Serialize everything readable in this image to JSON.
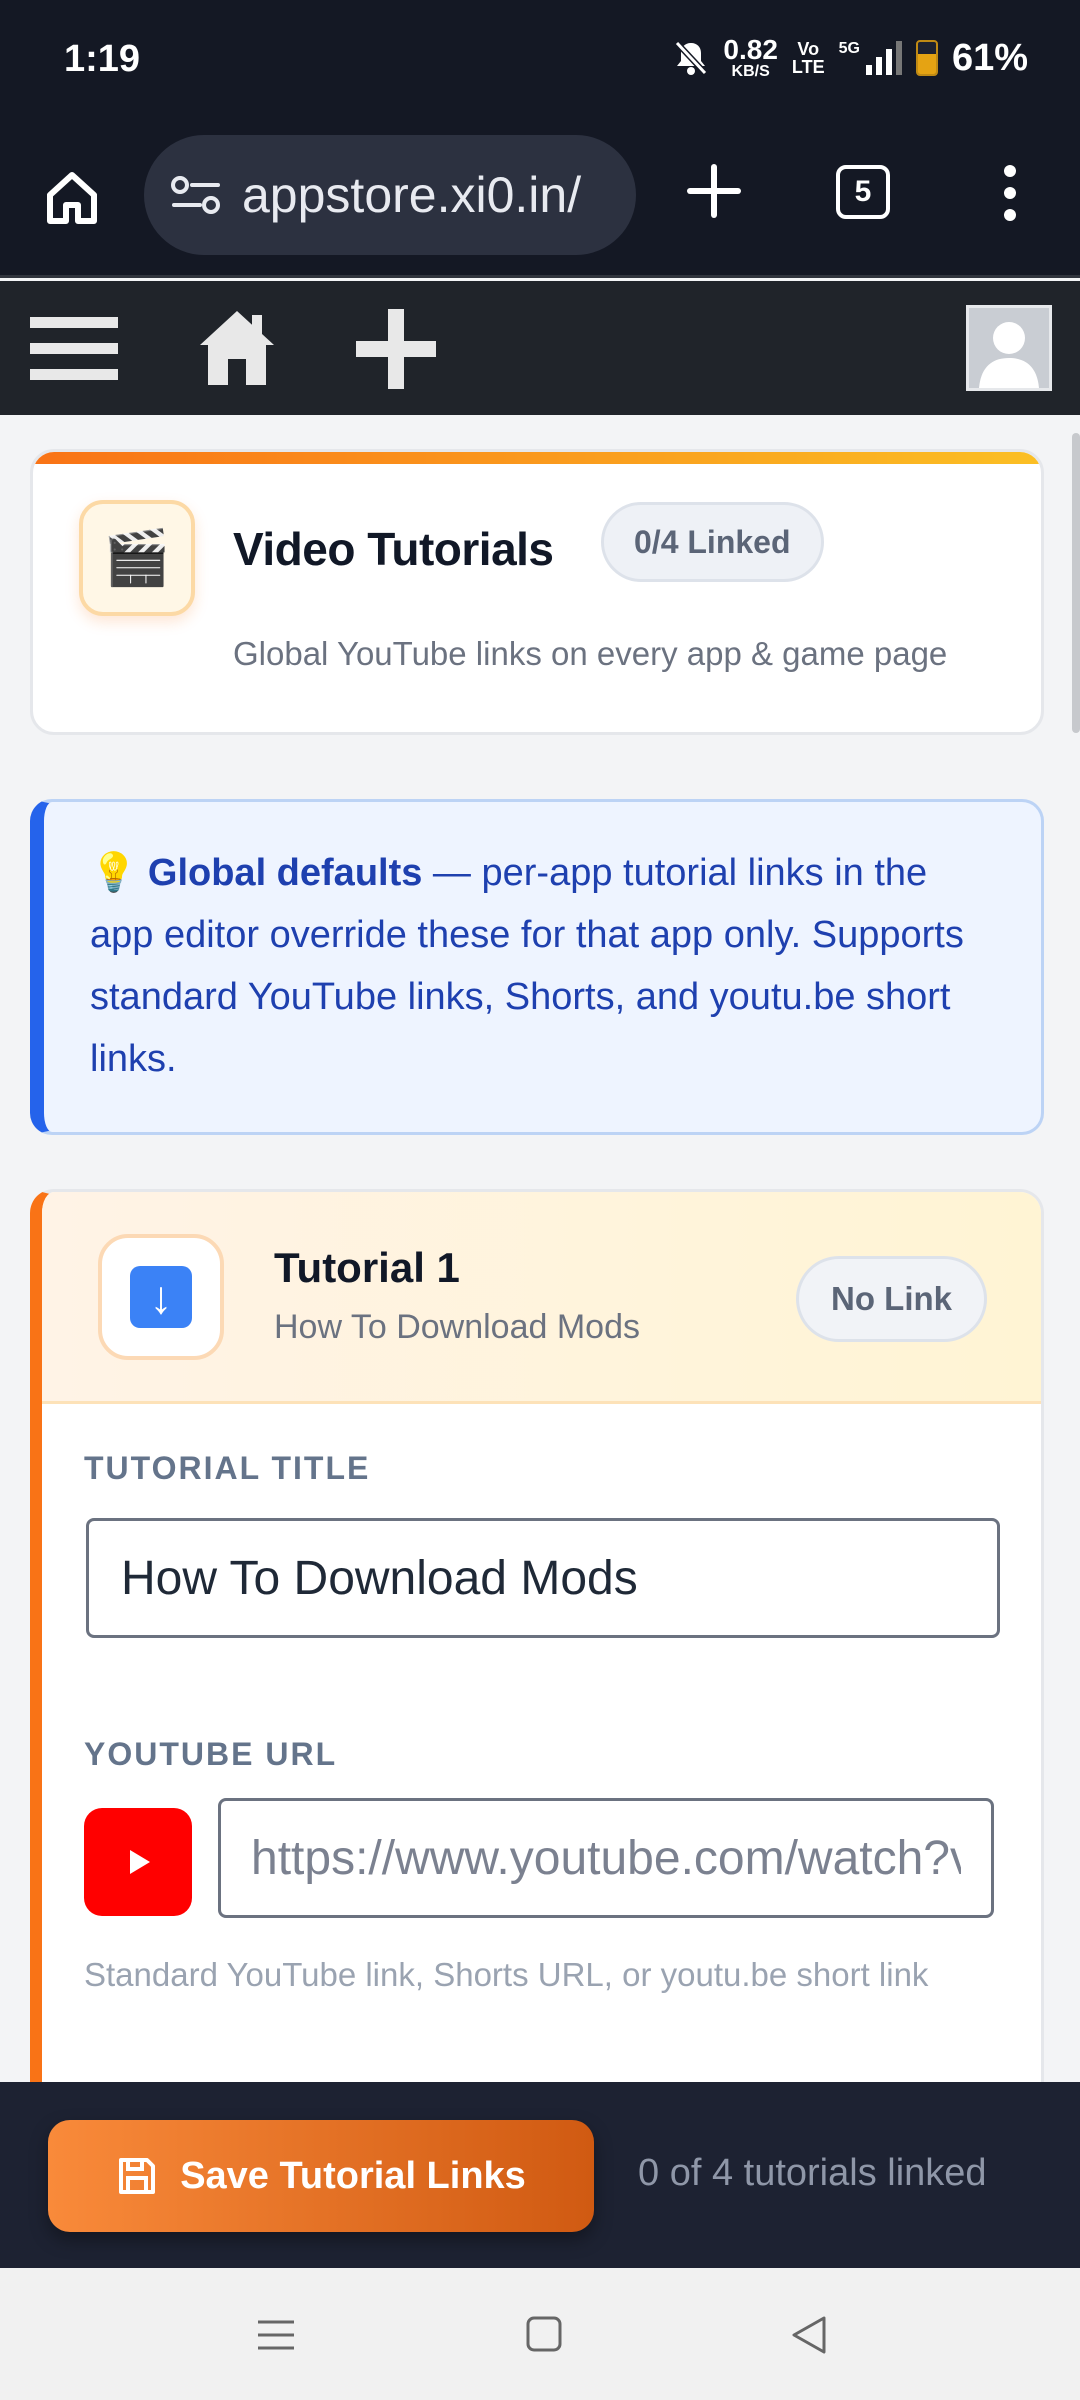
{
  "status_bar": {
    "time": "1:19",
    "net_speed_value": "0.82",
    "net_speed_unit": "KB/S",
    "volte_top": "Vo",
    "volte_bottom": "LTE",
    "network": "5G",
    "battery": "61%",
    "battery_level": 0.61
  },
  "browser": {
    "url": "appstore.xi0.in/",
    "tab_count": "5"
  },
  "header_card": {
    "icon": "clapperboard-icon",
    "title": "Video Tutorials",
    "badge": "0/4 Linked",
    "subtitle": "Global YouTube links on every app & game page"
  },
  "info_box": {
    "icon": "💡",
    "bold": "Global defaults",
    "text": " — per-app tutorial links in the app editor override these for that app only. Supports standard YouTube links, Shorts, and youtu.be short links."
  },
  "tutorial_1": {
    "name": "Tutorial 1",
    "subtitle": "How To Download Mods",
    "status": "No Link",
    "title_label": "TUTORIAL TITLE",
    "title_value": "How To Download Mods",
    "url_label": "YOUTUBE URL",
    "url_placeholder": "https://www.youtube.com/watch?v=...",
    "help": "Standard YouTube link, Shorts URL, or youtu.be short link"
  },
  "save_bar": {
    "button_label": "Save Tutorial Links",
    "count_text": "0 of 4 tutorials linked"
  },
  "colors": {
    "accent_orange": "#f97316",
    "info_blue": "#2563eb",
    "youtube_red": "#ff0000",
    "dark_bar": "#141824"
  }
}
